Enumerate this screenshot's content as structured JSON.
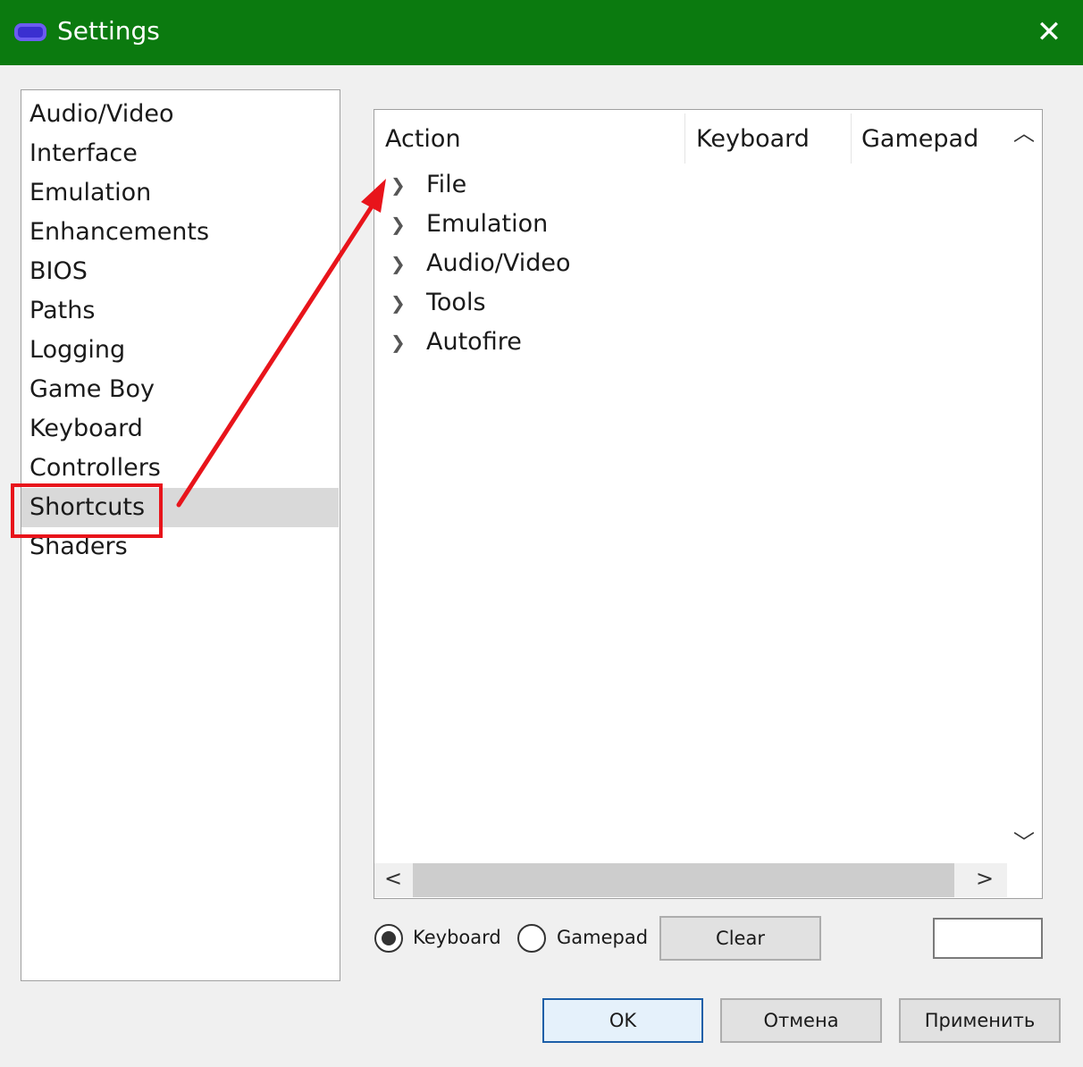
{
  "window": {
    "title": "Settings",
    "app_icon": "gameboy-advance-icon",
    "close_icon": "close-icon",
    "titlebar_color": "#0b7a0f"
  },
  "sidebar": {
    "items": [
      {
        "label": "Audio/Video"
      },
      {
        "label": "Interface"
      },
      {
        "label": "Emulation"
      },
      {
        "label": "Enhancements"
      },
      {
        "label": "BIOS"
      },
      {
        "label": "Paths"
      },
      {
        "label": "Logging"
      },
      {
        "label": "Game Boy"
      },
      {
        "label": "Keyboard"
      },
      {
        "label": "Controllers"
      },
      {
        "label": "Shortcuts",
        "selected": true
      },
      {
        "label": "Shaders"
      }
    ]
  },
  "annotation": {
    "color": "#e8141b",
    "highlight": "Shortcuts",
    "arrow_target": "File"
  },
  "tree": {
    "columns": [
      "Action",
      "Keyboard",
      "Gamepad"
    ],
    "rows": [
      {
        "label": "File"
      },
      {
        "label": "Emulation"
      },
      {
        "label": "Audio/Video"
      },
      {
        "label": "Tools"
      },
      {
        "label": "Autofire"
      }
    ]
  },
  "controls": {
    "radio_keyboard": "Keyboard",
    "radio_gamepad": "Gamepad",
    "selected_radio": "Keyboard",
    "clear": "Clear",
    "input_value": ""
  },
  "buttons": {
    "ok": "OK",
    "cancel": "Отмена",
    "apply": "Применить"
  }
}
